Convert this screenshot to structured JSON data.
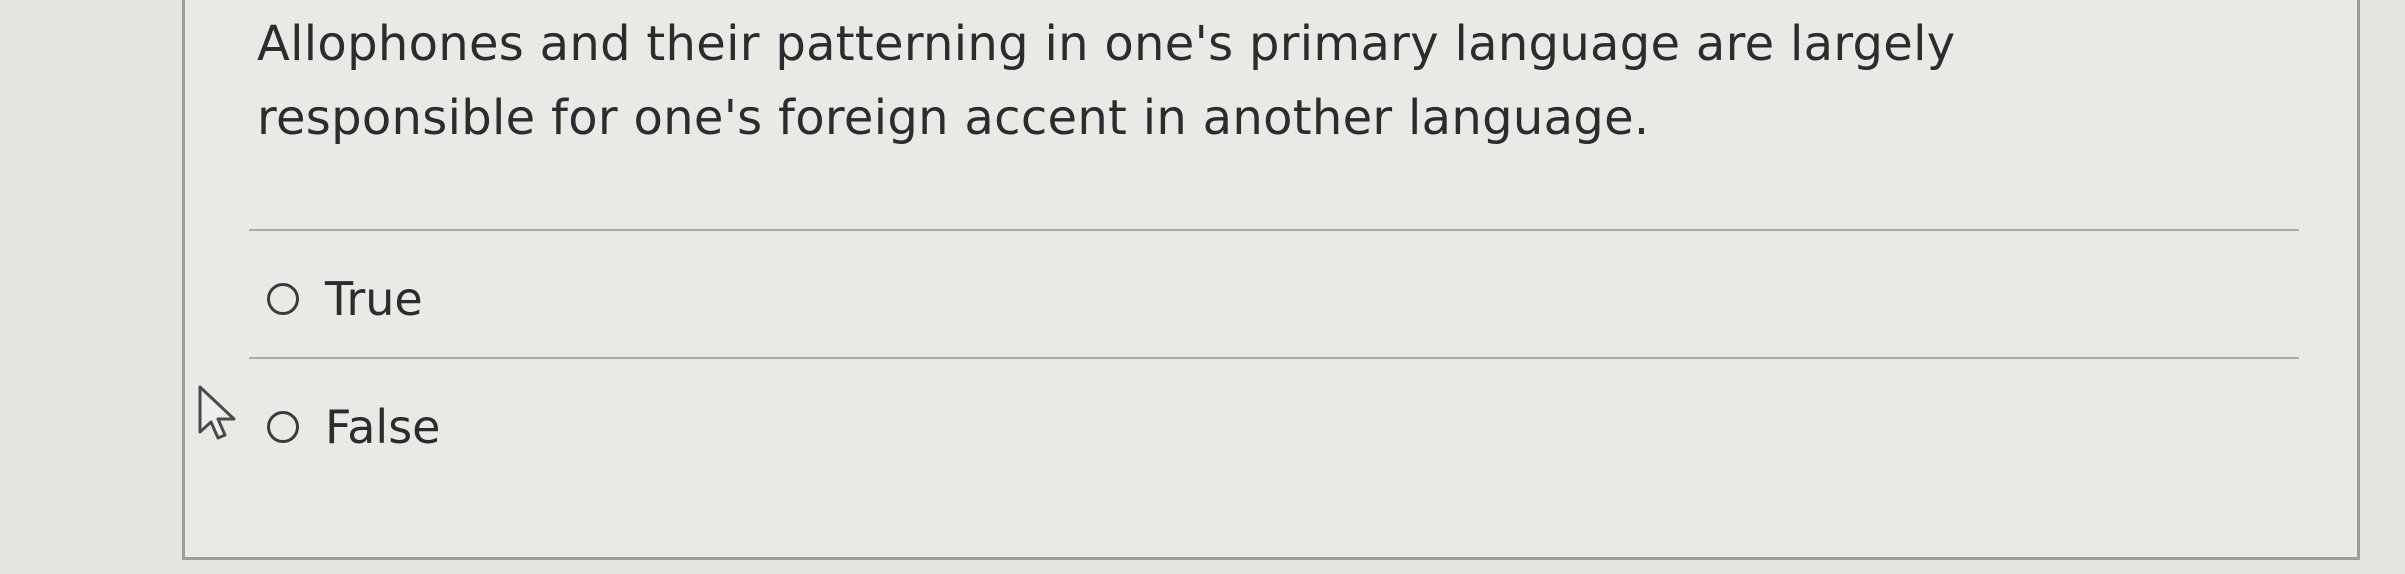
{
  "question": {
    "line1": "Allophones and their patterning in one's primary language are largely",
    "line2": "responsible for one's foreign accent in another language."
  },
  "options": [
    {
      "label": "True",
      "selected": false
    },
    {
      "label": "False",
      "selected": false
    }
  ],
  "icons": {
    "cursor": "mouse-pointer-icon",
    "radio": "radio-button-icon"
  }
}
